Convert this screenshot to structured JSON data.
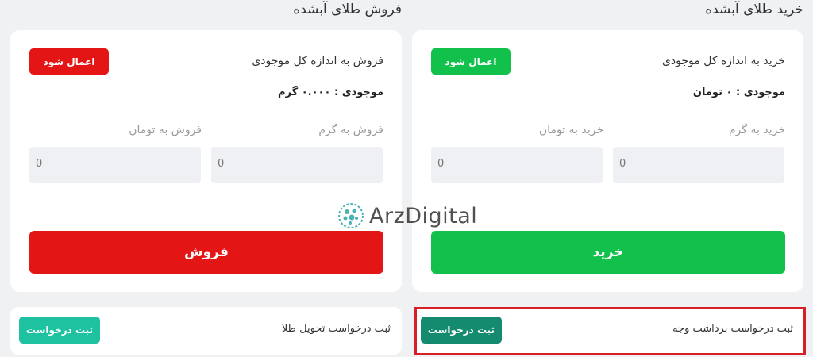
{
  "buy": {
    "section_title": "خرید طلای آبشده",
    "title": "خرید به اندازه کل موجودی",
    "apply_label": "اعمال شود",
    "balance": "موجودی : ۰ تومان",
    "gram_label": "خرید به گرم",
    "toman_label": "خرید به تومان",
    "gram_value": "0",
    "toman_value": "0",
    "submit_label": "خرید",
    "color": "#12c04c"
  },
  "sell": {
    "section_title": "فروش طلای آبشده",
    "title": "فروش به اندازه کل موجودی",
    "apply_label": "اعمال شود",
    "balance": "موجودی : ۰.۰۰۰ گرم",
    "gram_label": "فروش به گرم",
    "toman_label": "فروش به تومان",
    "gram_value": "0",
    "toman_value": "0",
    "submit_label": "فروش",
    "color": "#e31515"
  },
  "requests": {
    "delivery_text": "ثبت درخواست تحویل طلا",
    "delivery_button": "ثبت درخواست",
    "withdraw_text": "ثبت درخواست برداشت وجه",
    "withdraw_button": "ثبت درخواست",
    "delivery_color": "#1ec1a0",
    "withdraw_color": "#148a6e",
    "highlight_color": "#d61f26"
  },
  "watermark": {
    "text": "ArzDigital",
    "icon": "arzdigital-logo-icon"
  }
}
